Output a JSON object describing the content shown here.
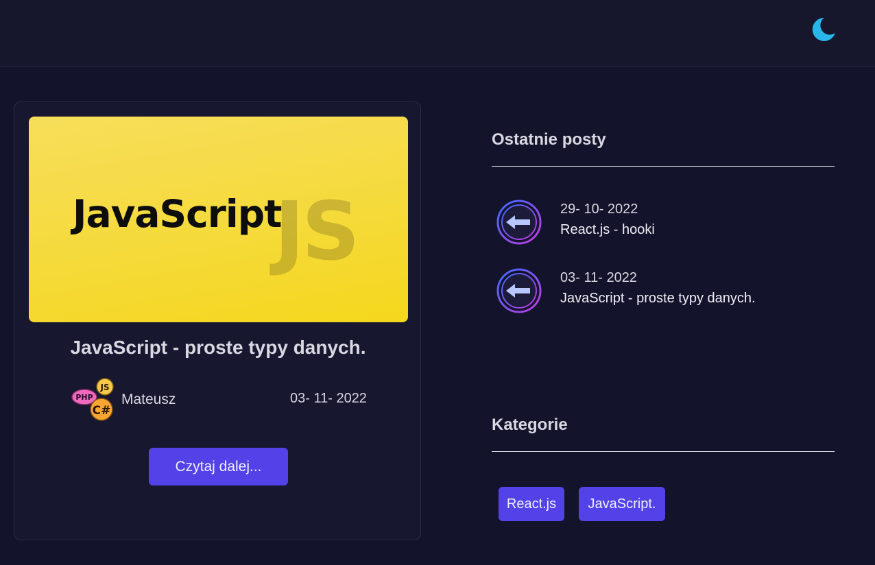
{
  "header": {
    "theme_toggle_icon": "moon-icon",
    "accent_color": "#29b6e8"
  },
  "post": {
    "image_text_main": "JavaScript",
    "image_text_badge": "JS",
    "title": "JavaScript - proste typy danych.",
    "author_avatar_badges": [
      "PHP",
      "JS",
      "C#"
    ],
    "author": "Mateusz",
    "date": "03- 11- 2022",
    "read_more_label": "Czytaj dalej..."
  },
  "sidebar": {
    "recent_heading": "Ostatnie posty",
    "recent_posts": [
      {
        "date": "29- 10- 2022",
        "title": "React.js - hooki",
        "icon": "arrow-left-icon"
      },
      {
        "date": "03- 11- 2022",
        "title": "JavaScript - proste typy danych.",
        "icon": "arrow-left-icon"
      }
    ],
    "categories_heading": "Kategorie",
    "categories": [
      "React.js",
      "JavaScript."
    ]
  },
  "colors": {
    "background": "#13132b",
    "button": "#5242e8",
    "image_yellow": "#f5d71c"
  }
}
